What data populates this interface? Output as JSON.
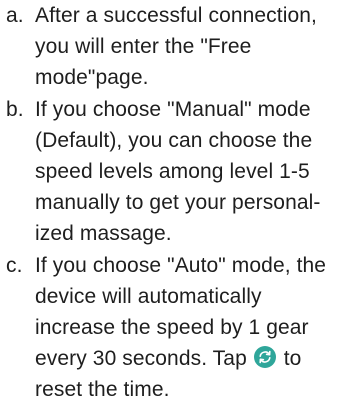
{
  "items": [
    {
      "marker": "a.",
      "lines": [
        "After a successful connection,",
        "you will enter the \"Free",
        "mode\"page."
      ]
    },
    {
      "marker": "b.",
      "lines": [
        "If you choose \"Manual\" mode",
        "(Default), you can choose the",
        "speed levels among level 1-5",
        "manually to get your personal-",
        "ized massage."
      ]
    },
    {
      "marker": "c.",
      "lines": [
        "If you choose \"Auto\" mode, the",
        "device will automatically",
        "increase the speed by 1 gear",
        "every 30 seconds. Tap",
        "to",
        "reset the time."
      ]
    }
  ],
  "icons": {
    "reset": "reset-icon"
  },
  "colors": {
    "text": "#1e1e1e",
    "icon_fill": "#2fa69a",
    "icon_glyph": "#ffffff"
  }
}
